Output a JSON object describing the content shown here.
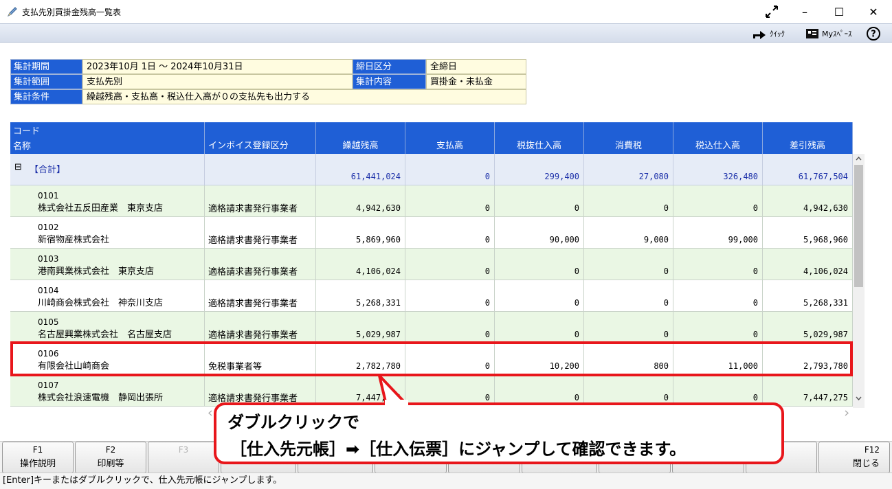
{
  "window": {
    "title": "支払先別買掛金残高一覧表",
    "controls": {
      "expand": "⤢",
      "minimize": "–",
      "maximize": "☐",
      "close": "✕"
    }
  },
  "toolbar": {
    "quick_label": "ｸｲｯｸ",
    "myspace_label": "Myｽﾍﾟｰｽ",
    "help_label": "?"
  },
  "conditions": {
    "period_label": "集計期間",
    "period_value": "2023年10月 1日 ～ 2024年10月31日",
    "closing_label": "締日区分",
    "closing_value": "全締日",
    "scope_label": "集計範囲",
    "scope_value": "支払先別",
    "content_label": "集計内容",
    "content_value": "買掛金・未払金",
    "condition_label": "集計条件",
    "condition_value": "繰越残高・支払高・税込仕入高が０の支払先も出力する"
  },
  "grid": {
    "headers": {
      "code": "コード",
      "name": "名称",
      "invoice": "インボイス登録区分",
      "carryover": "繰越残高",
      "payment": "支払高",
      "purchase_ex": "税抜仕入高",
      "tax": "消費税",
      "purchase_in": "税込仕入高",
      "balance": "差引残高"
    },
    "total": {
      "label": "【合計】",
      "toggle": "⊟",
      "carryover": "61,441,024",
      "payment": "0",
      "purchase_ex": "299,400",
      "tax": "27,080",
      "purchase_in": "326,480",
      "balance": "61,767,504"
    },
    "rows": [
      {
        "code": "0101",
        "name": "株式会社五反田産業　東京支店",
        "invoice": "適格請求書発行事業者",
        "carryover": "4,942,630",
        "payment": "0",
        "purchase_ex": "0",
        "tax": "0",
        "purchase_in": "0",
        "balance": "4,942,630"
      },
      {
        "code": "0102",
        "name": "新宿物産株式会社",
        "invoice": "適格請求書発行事業者",
        "carryover": "5,869,960",
        "payment": "0",
        "purchase_ex": "90,000",
        "tax": "9,000",
        "purchase_in": "99,000",
        "balance": "5,968,960"
      },
      {
        "code": "0103",
        "name": "港南興業株式会社　東京支店",
        "invoice": "適格請求書発行事業者",
        "carryover": "4,106,024",
        "payment": "0",
        "purchase_ex": "0",
        "tax": "0",
        "purchase_in": "0",
        "balance": "4,106,024"
      },
      {
        "code": "0104",
        "name": "川崎商会株式会社　神奈川支店",
        "invoice": "適格請求書発行事業者",
        "carryover": "5,268,331",
        "payment": "0",
        "purchase_ex": "0",
        "tax": "0",
        "purchase_in": "0",
        "balance": "5,268,331"
      },
      {
        "code": "0105",
        "name": "名古屋興業株式会社　名古屋支店",
        "invoice": "適格請求書発行事業者",
        "carryover": "5,029,987",
        "payment": "0",
        "purchase_ex": "0",
        "tax": "0",
        "purchase_in": "0",
        "balance": "5,029,987"
      },
      {
        "code": "0106",
        "name": "有限会社山崎商会",
        "invoice": "免税事業者等",
        "carryover": "2,782,780",
        "payment": "0",
        "purchase_ex": "10,200",
        "tax": "800",
        "purchase_in": "11,000",
        "balance": "2,793,780"
      },
      {
        "code": "0107",
        "name": "株式会社浪速電機　静岡出張所",
        "invoice": "適格請求書発行事業者",
        "carryover": "7,447,275",
        "payment": "0",
        "purchase_ex": "0",
        "tax": "0",
        "purchase_in": "0",
        "balance": "7,447,275"
      }
    ]
  },
  "callout": {
    "line1": "ダブルクリックで",
    "line2": "［仕入先元帳］➡［仕入伝票］にジャンプして確認できます。"
  },
  "fkeys": [
    {
      "key": "F1",
      "label": "操作説明",
      "enabled": true
    },
    {
      "key": "F2",
      "label": "印刷等",
      "enabled": true
    },
    {
      "key": "F3",
      "label": "",
      "enabled": false
    },
    {
      "key": "F12",
      "label": "閉じる",
      "enabled": true
    }
  ],
  "status": "[Enter]キーまたはダブルクリックで、仕入先元帳にジャンプします。",
  "colors": {
    "header_blue": "#1f5fd6",
    "row_green": "#eaf7e4",
    "highlight_red": "#e8161b",
    "info_value_bg": "#fffce0"
  }
}
